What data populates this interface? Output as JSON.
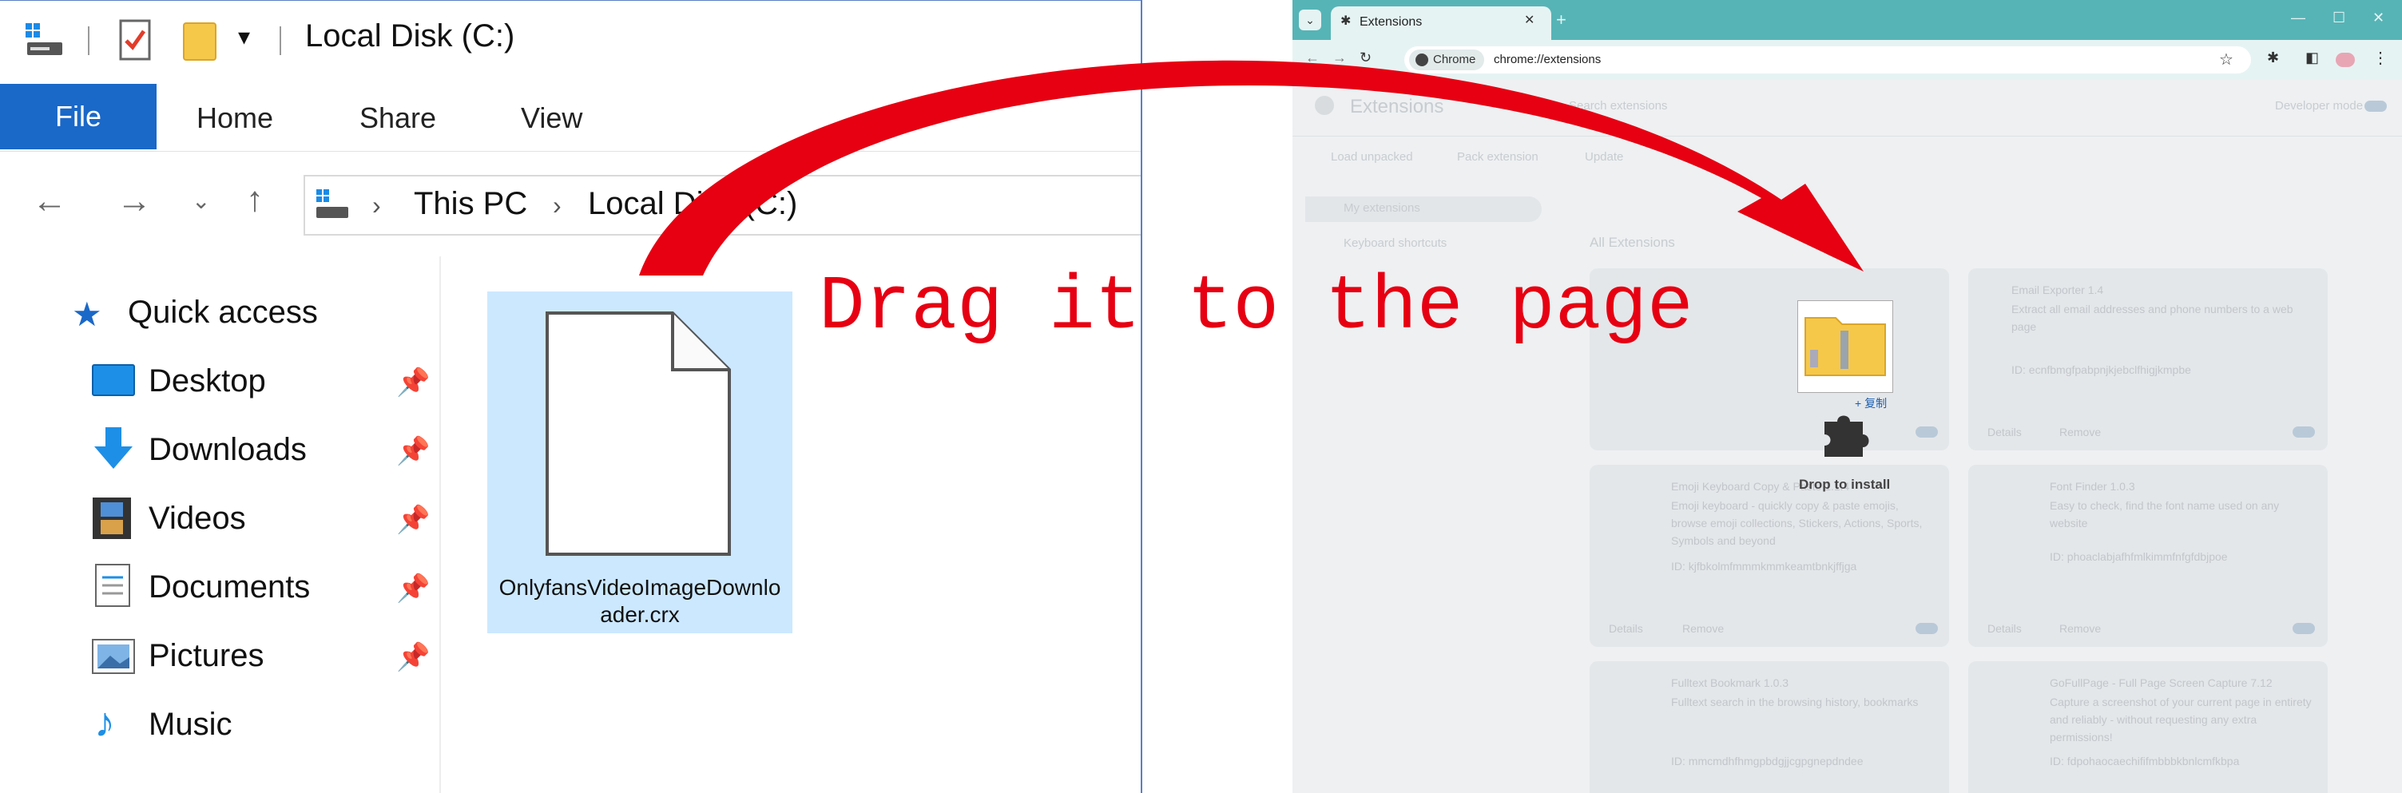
{
  "explorer": {
    "title": "Local Disk (C:)",
    "ribbon_tabs": [
      "File",
      "Home",
      "Share",
      "View"
    ],
    "breadcrumb": [
      "This PC",
      "Local Disk (C:)"
    ],
    "nav_items": [
      {
        "label": "Quick access",
        "icon": "star-icon"
      },
      {
        "label": "Desktop",
        "icon": "desktop-icon",
        "pinned": true
      },
      {
        "label": "Downloads",
        "icon": "download-arrow-icon",
        "pinned": true
      },
      {
        "label": "Videos",
        "icon": "film-icon",
        "pinned": true
      },
      {
        "label": "Documents",
        "icon": "document-icon",
        "pinned": true
      },
      {
        "label": "Pictures",
        "icon": "picture-icon",
        "pinned": true
      },
      {
        "label": "Music",
        "icon": "music-note-icon"
      }
    ],
    "file": {
      "name_line1": "OnlyfansVideoImageDownlo",
      "name_line2": "ader.crx"
    }
  },
  "chrome": {
    "tab_title": "Extensions",
    "chip_label": "Chrome",
    "url": "chrome://extensions",
    "page_title": "Extensions",
    "search_placeholder": "Search extensions",
    "developer_mode": "Developer mode",
    "buttons": [
      "Load unpacked",
      "Pack extension",
      "Update"
    ],
    "sidebar": [
      "My extensions",
      "Keyboard shortcuts"
    ],
    "section_title": "All Extensions",
    "cards": [
      {
        "name": "Email Exporter 1.4",
        "desc": "Extract all email addresses and phone numbers to a web page",
        "id": "ID: ecnfbmgfpabpnjkjebclfhigjkmpbe",
        "actions": [
          "Details",
          "Remove"
        ]
      },
      {
        "name": "Emoji Keyboard Copy & Paste 1.1.4",
        "desc": "Emoji keyboard - quickly copy & paste emojis, browse emoji collections, Stickers, Actions, Sports, Symbols and beyond",
        "id": "ID: kjfbkolmfmmmkmmkeamtbnkjffjga",
        "actions": [
          "Details",
          "Remove"
        ]
      },
      {
        "name": "Font Finder 1.0.3",
        "desc": "Easy to check, find the font name used on any website",
        "id": "ID: phoaclabjafhfmlkimmfnfgfdbjpoe",
        "actions": [
          "Details",
          "Remove"
        ]
      },
      {
        "name": "Fulltext Bookmark 1.0.3",
        "desc": "Fulltext search in the browsing history, bookmarks",
        "id": "ID: mmcmdhfhmgpbdgjjcgpgnepdndee",
        "actions": [
          "Details",
          "Remove"
        ]
      },
      {
        "name": "GoFullPage - Full Page Screen Capture 7.12",
        "desc": "Capture a screenshot of your current page in entirety and reliably - without requesting any extra permissions!",
        "id": "ID: fdpohaocaechififmbbbkbnlcmfkbpa",
        "actions": [
          "Details",
          "Remove"
        ]
      }
    ]
  },
  "overlay": {
    "instruction": "Drag it to the page",
    "copy_label": "+ 复制",
    "drop_label": "Drop to install"
  },
  "colors": {
    "arrow": "#e60012",
    "explorer_accent": "#1a68c8",
    "chrome_tabbar": "#56b4b6"
  }
}
